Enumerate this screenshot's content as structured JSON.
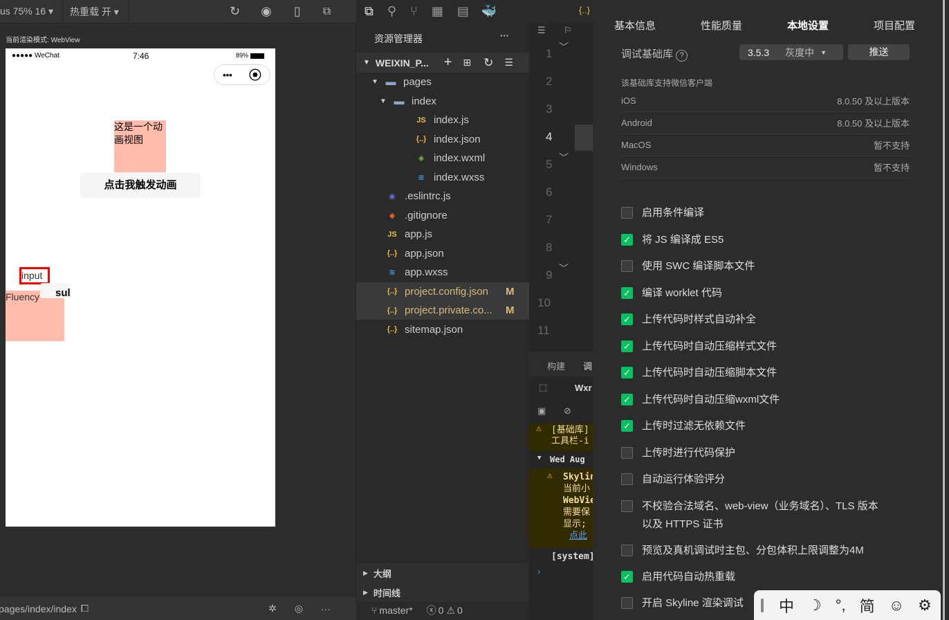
{
  "simulator": {
    "device": "us 75% 16",
    "hot_reload": "热重载 开",
    "render_mode_label": "当前渲染模式:",
    "render_mode": "WebView",
    "status": {
      "carrier": "●●●●● WeChat",
      "time": "7:46",
      "battery": "89%"
    },
    "anim_text": "这是一个动画视图",
    "anim_button": "点击我触发动画",
    "input_text": "input",
    "submit_text": "sul",
    "fluency": "Fluency",
    "path": "pages/index/index"
  },
  "explorer": {
    "title": "资源管理器",
    "more": "···",
    "project": "WEIXIN_P...",
    "items": [
      {
        "name": "pages",
        "type": "folder",
        "indent": 1,
        "icon": "▾"
      },
      {
        "name": "index",
        "type": "folder",
        "indent": 2,
        "icon": "▾"
      },
      {
        "name": "index.js",
        "type": "js",
        "indent": 3
      },
      {
        "name": "index.json",
        "type": "json",
        "indent": 3
      },
      {
        "name": "index.wxml",
        "type": "wxml",
        "indent": 3
      },
      {
        "name": "index.wxss",
        "type": "wxss",
        "indent": 3
      },
      {
        "name": ".eslintrc.js",
        "type": "eslint",
        "indent": 1
      },
      {
        "name": ".gitignore",
        "type": "git",
        "indent": 1
      },
      {
        "name": "app.js",
        "type": "js",
        "indent": 1
      },
      {
        "name": "app.json",
        "type": "json",
        "indent": 1
      },
      {
        "name": "app.wxss",
        "type": "wxss",
        "indent": 1
      },
      {
        "name": "project.config.json",
        "type": "json",
        "indent": 1,
        "badge": "M"
      },
      {
        "name": "project.private.co...",
        "type": "json",
        "indent": 1,
        "badge": "M"
      },
      {
        "name": "sitemap.json",
        "type": "json",
        "indent": 1
      }
    ],
    "outline": "大纲",
    "timeline": "时间线",
    "branch": "master*",
    "errors": "0",
    "warnings": "0"
  },
  "editor": {
    "line_numbers": [
      "1",
      "2",
      "3",
      "4",
      "5",
      "6",
      "7",
      "8",
      "9",
      "10",
      "11"
    ],
    "active_line": "4",
    "bottom_tabs": [
      "构建",
      "调"
    ],
    "devtools_tab": "Wxr",
    "console": [
      "[基础库]",
      "工具栏-i",
      "Wed Aug",
      "Skylin",
      "当前小",
      "WebVie",
      "需要保",
      "显示;",
      "点此",
      "[system]"
    ]
  },
  "settings": {
    "tabs": [
      "基本信息",
      "性能质量",
      "本地设置",
      "项目配置"
    ],
    "active_tab": "本地设置",
    "debug_lib_label": "调试基础库",
    "version": "3.5.3",
    "channel": "灰度中",
    "push": "推送",
    "client_title": "该基础库支持微信客户端",
    "clients": [
      {
        "os": "iOS",
        "v": "8.0.50 及以上版本"
      },
      {
        "os": "Android",
        "v": "8.0.50 及以上版本"
      },
      {
        "os": "MacOS",
        "v": "暂不支持"
      },
      {
        "os": "Windows",
        "v": "暂不支持"
      }
    ],
    "options": [
      {
        "label": "启用条件编译",
        "checked": false
      },
      {
        "label": "将 JS 编译成 ES5",
        "checked": true
      },
      {
        "label": "使用 SWC 编译脚本文件",
        "checked": false
      },
      {
        "label": "编译 worklet 代码",
        "checked": true
      },
      {
        "label": "上传代码时样式自动补全",
        "checked": true
      },
      {
        "label": "上传代码时自动压缩样式文件",
        "checked": true
      },
      {
        "label": "上传代码时自动压缩脚本文件",
        "checked": true
      },
      {
        "label": "上传代码时自动压缩wxml文件",
        "checked": true
      },
      {
        "label": "上传时过滤无依赖文件",
        "checked": true
      },
      {
        "label": "上传时进行代码保护",
        "checked": false
      },
      {
        "label": "自动运行体验评分",
        "checked": false
      },
      {
        "label": "不校验合法域名、web-view（业务域名）、TLS 版本以及 HTTPS 证书",
        "checked": false
      },
      {
        "label": "预览及真机调试时主包、分包体积上限调整为4M",
        "checked": false
      },
      {
        "label": "启用代码自动热重载",
        "checked": true
      },
      {
        "label": "开启 Skyline 渲染调试",
        "checked": false
      }
    ]
  },
  "ime": {
    "items": [
      "中",
      "☽",
      "°,",
      "简",
      "☺",
      "⚙"
    ]
  },
  "colors": {
    "accent": "#07c160",
    "modified": "#d7ba7d",
    "json_icon": "#e8b93a"
  }
}
